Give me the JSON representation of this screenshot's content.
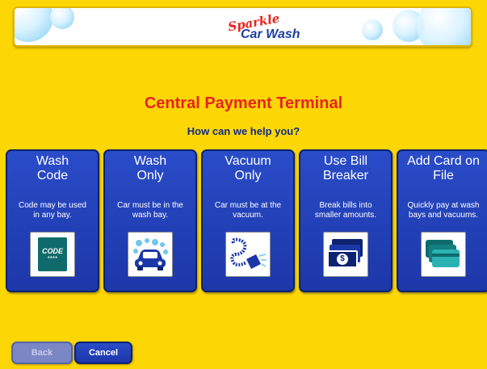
{
  "header": {
    "logo_script": "Sparkle",
    "logo_name": "Car Wash"
  },
  "main": {
    "title": "Central Payment Terminal",
    "prompt": "How can we help you?"
  },
  "options": [
    {
      "title_line1": "Wash",
      "title_line2": "Code",
      "desc_line1": "Code may be used",
      "desc_line2": "in any bay.",
      "icon": "code-card-icon",
      "icon_text": "CODE",
      "icon_stars": "****"
    },
    {
      "title_line1": "Wash",
      "title_line2": "Only",
      "desc_line1": "Car must be in the",
      "desc_line2": "wash bay.",
      "icon": "car-wash-icon"
    },
    {
      "title_line1": "Vacuum",
      "title_line2": "Only",
      "desc_line1": "Car must be at the",
      "desc_line2": "vacuum.",
      "icon": "vacuum-hose-icon"
    },
    {
      "title_line1": "Use Bill",
      "title_line2": "Breaker",
      "desc_line1": "Break bills into",
      "desc_line2": "smaller amounts.",
      "icon": "money-bills-icon",
      "icon_symbol": "$"
    },
    {
      "title_line1": "Add Card on",
      "title_line2": "File",
      "desc_line1": "Quickly pay at wash",
      "desc_line2": "bays and vacuums.",
      "icon": "credit-cards-icon"
    }
  ],
  "footer": {
    "back_label": "Back",
    "cancel_label": "Cancel"
  },
  "colors": {
    "background": "#fdd605",
    "title": "#e8231d",
    "button": "#1c37a8",
    "prompt": "#0f2a8c"
  }
}
